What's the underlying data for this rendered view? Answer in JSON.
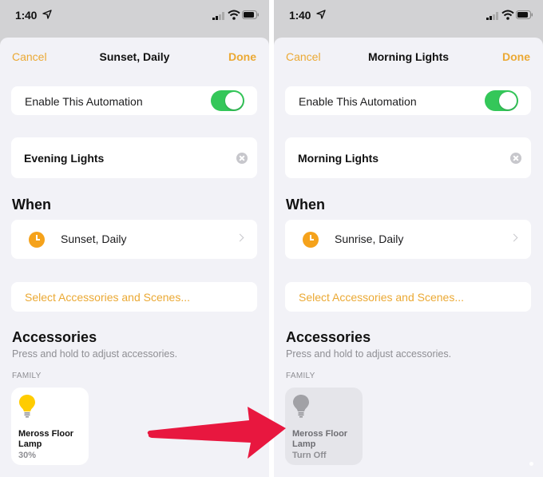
{
  "colors": {
    "accent": "#eba934",
    "toggle_on": "#34c759",
    "clock_orange": "#f5a21b",
    "bulb_on": "#ffcc00",
    "bulb_off": "#a1a1a6",
    "arrow_red": "#e8173f"
  },
  "panes": [
    {
      "status": {
        "time": "1:40"
      },
      "nav": {
        "cancel": "Cancel",
        "title": "Sunset, Daily",
        "done": "Done"
      },
      "enable": {
        "label": "Enable This Automation",
        "on": true
      },
      "name_field": {
        "value": "Evening Lights"
      },
      "when": {
        "heading": "When",
        "trigger": "Sunset, Daily"
      },
      "select_label": "Select Accessories and Scenes...",
      "accessories": {
        "heading": "Accessories",
        "hint": "Press and hold to adjust accessories.",
        "group": "FAMILY",
        "tile": {
          "name": "Meross Floor Lamp",
          "state": "30%",
          "on": true
        }
      }
    },
    {
      "status": {
        "time": "1:40"
      },
      "nav": {
        "cancel": "Cancel",
        "title": "Morning Lights",
        "done": "Done"
      },
      "enable": {
        "label": "Enable This Automation",
        "on": true
      },
      "name_field": {
        "value": "Morning Lights"
      },
      "when": {
        "heading": "When",
        "trigger": "Sunrise, Daily"
      },
      "select_label": "Select Accessories and Scenes...",
      "accessories": {
        "heading": "Accessories",
        "hint": "Press and hold to adjust accessories.",
        "group": "FAMILY",
        "tile": {
          "name": "Meross Floor Lamp",
          "state": "Turn Off",
          "on": false
        }
      }
    }
  ]
}
